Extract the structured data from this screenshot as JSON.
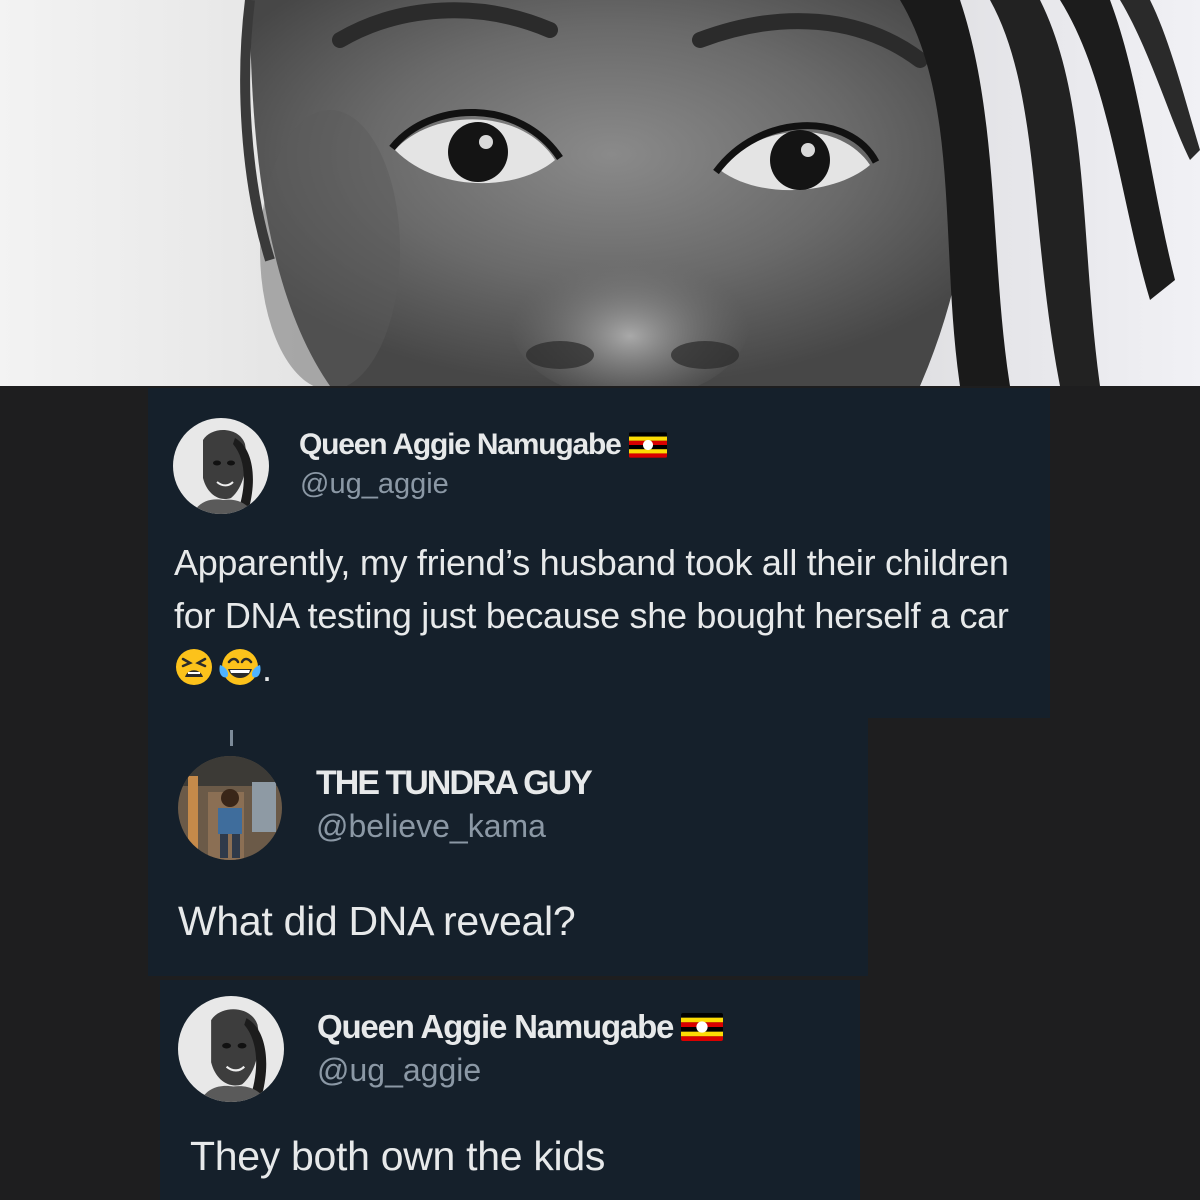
{
  "tweet_original": {
    "display_name": "Queen Aggie Namugabe",
    "flag_icon": "uganda-flag-icon",
    "handle": "@ug_aggie",
    "text_before_emoji": "Apparently, my friend’s husband took all their children for DNA testing just because she bought herself a car ",
    "emojis": [
      "tired-face-emoji",
      "tears-of-joy-emoji"
    ],
    "text_after_emoji": "."
  },
  "tweet_reply": {
    "display_name": "THE TUNDRA GUY",
    "handle": "@believe_kama",
    "text": "What did DNA reveal?"
  },
  "tweet_answer": {
    "display_name": "Queen Aggie Namugabe",
    "flag_icon": "uganda-flag-icon",
    "handle": "@ug_aggie",
    "text": "They both own the kids"
  },
  "colors": {
    "tweet_background": "#15202b",
    "page_background": "#1e1e1f",
    "name_text": "#e7e9ea",
    "handle_text": "#8b98a5",
    "flag_black": "#000000",
    "flag_yellow": "#fcdc04",
    "flag_red": "#d90000"
  }
}
